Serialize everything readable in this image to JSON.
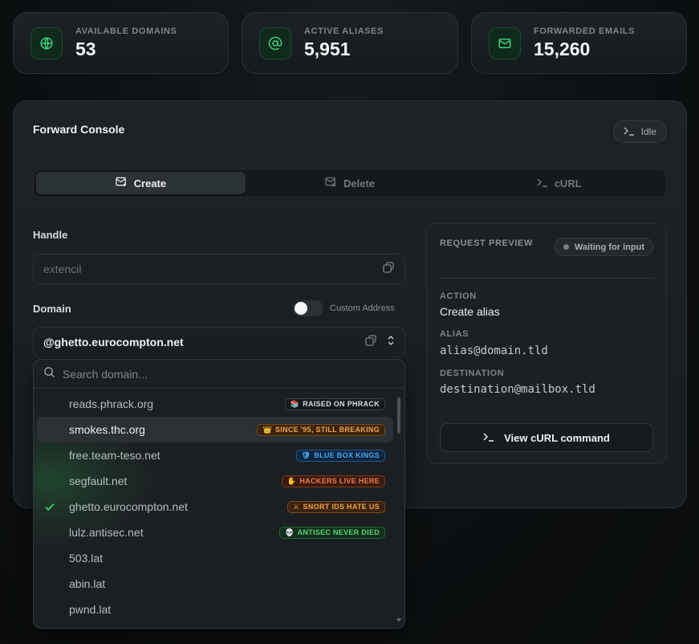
{
  "stats": [
    {
      "label": "AVAILABLE DOMAINS",
      "value": "53",
      "icon": "globe-icon"
    },
    {
      "label": "ACTIVE ALIASES",
      "value": "5,951",
      "icon": "at-icon"
    },
    {
      "label": "FORWARDED EMAILS",
      "value": "15,260",
      "icon": "mail-icon"
    }
  ],
  "console": {
    "title": "Forward Console",
    "status": "Idle",
    "tabs": [
      {
        "label": "Create",
        "active": true
      },
      {
        "label": "Delete",
        "active": false
      },
      {
        "label": "cURL",
        "active": false
      }
    ],
    "handle": {
      "label": "Handle",
      "placeholder": "extencil"
    },
    "domain": {
      "label": "Domain",
      "toggle_label": "Custom Address",
      "toggle_on": false,
      "value": "@ghetto.eurocompton.net"
    }
  },
  "preview": {
    "title": "REQUEST PREVIEW",
    "status": "Waiting for input",
    "action_label": "ACTION",
    "action_value": "Create alias",
    "alias_label": "ALIAS",
    "alias_value": "alias@domain.tld",
    "destination_label": "DESTINATION",
    "destination_value": "destination@mailbox.tld",
    "curl_button": "View cURL command"
  },
  "dropdown": {
    "search_placeholder": "Search domain...",
    "options": [
      {
        "name": "reads.phrack.org",
        "tag": "RAISED ON PHRACK",
        "tag_icon": "📚",
        "tag_fg": "#d9dcde",
        "tag_bg": "#15181a",
        "tag_border": "#3a4044"
      },
      {
        "name": "smokes.thc.org",
        "tag": "SINCE '95, STILL BREAKING",
        "tag_icon": "👑",
        "tag_fg": "#f0a24a",
        "tag_bg": "#3a2410",
        "tag_border": "#7a4a1c",
        "highlighted": true
      },
      {
        "name": "free.team-teso.net",
        "tag": "BLUE BOX KINGS",
        "tag_icon": "🛡",
        "tag_fg": "#4aa8f0",
        "tag_bg": "#0f2540",
        "tag_border": "#1e5a8e"
      },
      {
        "name": "segfault.net",
        "tag": "HACKERS LIVE HERE",
        "tag_icon": "✋",
        "tag_fg": "#f07a4a",
        "tag_bg": "#3a1a10",
        "tag_border": "#7a3a1c"
      },
      {
        "name": "ghetto.eurocompton.net",
        "tag": "SNORT IDS HATE US",
        "tag_icon": "⚔",
        "tag_fg": "#f0a24a",
        "tag_bg": "#3a2410",
        "tag_border": "#7a4a1c",
        "selected": true
      },
      {
        "name": "lulz.antisec.net",
        "tag": "ANTISEC NEVER DIED",
        "tag_icon": "💀",
        "tag_fg": "#5ad07a",
        "tag_bg": "#10301c",
        "tag_border": "#1e6a3a"
      },
      {
        "name": "503.lat"
      },
      {
        "name": "abin.lat"
      },
      {
        "name": "pwnd.lat"
      }
    ]
  },
  "colors": {
    "accent_green": "#3ecf7a"
  }
}
